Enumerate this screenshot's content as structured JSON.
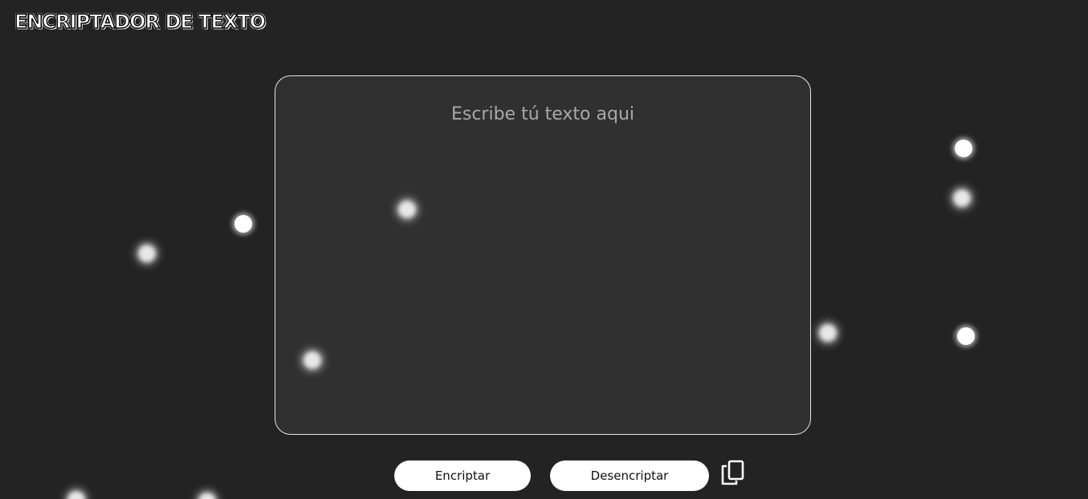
{
  "header": {
    "title": "ENCRIPTADOR DE TEXTO"
  },
  "editor": {
    "placeholder": "Escribe tú texto aqui",
    "value": ""
  },
  "actions": {
    "encrypt_label": "Encriptar",
    "decrypt_label": "Desencriptar",
    "copy_icon": "copy-icon"
  },
  "colors": {
    "background": "#232323",
    "panel_border": "#e6e6e6",
    "button_bg": "#ffffff",
    "dot": "#ffffff"
  }
}
